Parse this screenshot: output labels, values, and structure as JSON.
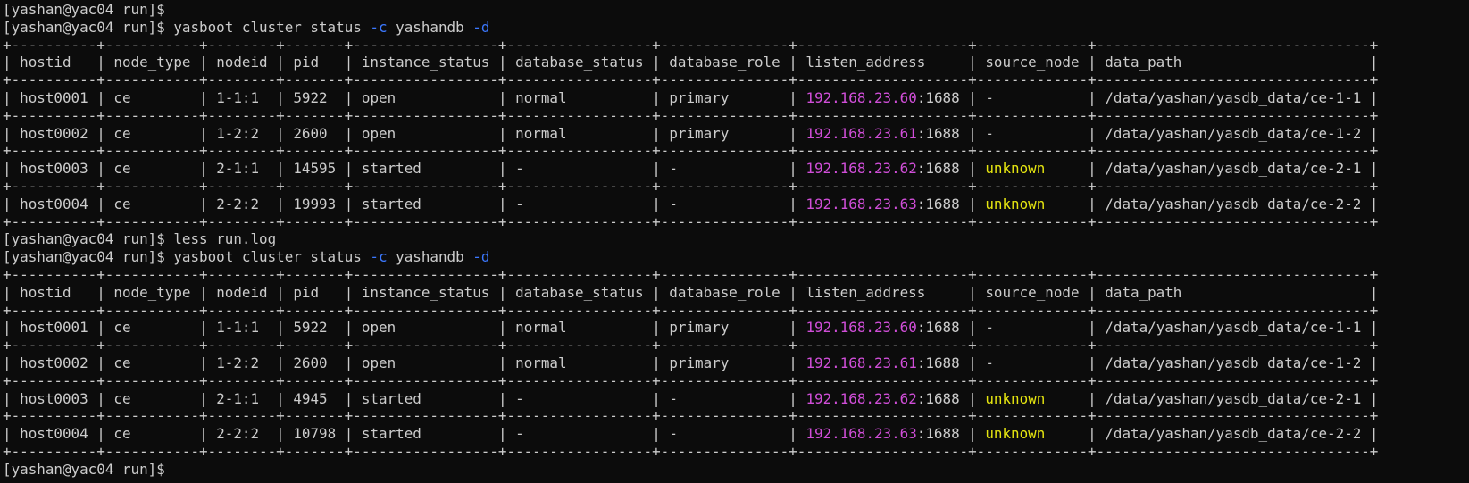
{
  "colors": {
    "background": "#0c0c0c",
    "text": "#cccccc",
    "option": "#3b78ff",
    "ip": "#d04ed8",
    "unknown": "#e5e510"
  },
  "terminal": {
    "lines": [
      {
        "kind": "prompt",
        "prompt": "[yashan@yac04 run]$",
        "cmd": ""
      },
      {
        "kind": "prompt",
        "prompt": "[yashan@yac04 run]$",
        "cmd": " yasboot cluster status",
        "opt1": "-c",
        "arg1": "yashandb",
        "opt2": "-d"
      },
      {
        "kind": "rule"
      },
      {
        "kind": "header",
        "cells": [
          "hostid",
          "node_type",
          "nodeid",
          "pid",
          "instance_status",
          "database_status",
          "database_role",
          "listen_address",
          "source_node",
          "data_path"
        ]
      },
      {
        "kind": "rule"
      },
      {
        "kind": "row",
        "hostid": "host0001",
        "node_type": "ce",
        "nodeid": "1-1:1",
        "pid": "5922",
        "instance_status": "open",
        "database_status": "normal",
        "database_role": "primary",
        "ip": "192.168.23.60",
        "port": ":1688",
        "source_node": "-",
        "source_warn": false,
        "data_path": "/data/yashan/yasdb_data/ce-1-1"
      },
      {
        "kind": "rule"
      },
      {
        "kind": "row",
        "hostid": "host0002",
        "node_type": "ce",
        "nodeid": "1-2:2",
        "pid": "2600",
        "instance_status": "open",
        "database_status": "normal",
        "database_role": "primary",
        "ip": "192.168.23.61",
        "port": ":1688",
        "source_node": "-",
        "source_warn": false,
        "data_path": "/data/yashan/yasdb_data/ce-1-2"
      },
      {
        "kind": "rule"
      },
      {
        "kind": "row",
        "hostid": "host0003",
        "node_type": "ce",
        "nodeid": "2-1:1",
        "pid": "14595",
        "instance_status": "started",
        "database_status": "-",
        "database_role": "-",
        "ip": "192.168.23.62",
        "port": ":1688",
        "source_node": "unknown",
        "source_warn": true,
        "data_path": "/data/yashan/yasdb_data/ce-2-1"
      },
      {
        "kind": "rule"
      },
      {
        "kind": "row",
        "hostid": "host0004",
        "node_type": "ce",
        "nodeid": "2-2:2",
        "pid": "19993",
        "instance_status": "started",
        "database_status": "-",
        "database_role": "-",
        "ip": "192.168.23.63",
        "port": ":1688",
        "source_node": "unknown",
        "source_warn": true,
        "data_path": "/data/yashan/yasdb_data/ce-2-2"
      },
      {
        "kind": "rule"
      },
      {
        "kind": "prompt",
        "prompt": "[yashan@yac04 run]$",
        "cmd": " less run.log"
      },
      {
        "kind": "prompt",
        "prompt": "[yashan@yac04 run]$",
        "cmd": " yasboot cluster status",
        "opt1": "-c",
        "arg1": "yashandb",
        "opt2": "-d"
      },
      {
        "kind": "rule"
      },
      {
        "kind": "header",
        "cells": [
          "hostid",
          "node_type",
          "nodeid",
          "pid",
          "instance_status",
          "database_status",
          "database_role",
          "listen_address",
          "source_node",
          "data_path"
        ]
      },
      {
        "kind": "rule"
      },
      {
        "kind": "row",
        "hostid": "host0001",
        "node_type": "ce",
        "nodeid": "1-1:1",
        "pid": "5922",
        "instance_status": "open",
        "database_status": "normal",
        "database_role": "primary",
        "ip": "192.168.23.60",
        "port": ":1688",
        "source_node": "-",
        "source_warn": false,
        "data_path": "/data/yashan/yasdb_data/ce-1-1"
      },
      {
        "kind": "rule"
      },
      {
        "kind": "row",
        "hostid": "host0002",
        "node_type": "ce",
        "nodeid": "1-2:2",
        "pid": "2600",
        "instance_status": "open",
        "database_status": "normal",
        "database_role": "primary",
        "ip": "192.168.23.61",
        "port": ":1688",
        "source_node": "-",
        "source_warn": false,
        "data_path": "/data/yashan/yasdb_data/ce-1-2"
      },
      {
        "kind": "rule"
      },
      {
        "kind": "row",
        "hostid": "host0003",
        "node_type": "ce",
        "nodeid": "2-1:1",
        "pid": "4945",
        "instance_status": "started",
        "database_status": "-",
        "database_role": "-",
        "ip": "192.168.23.62",
        "port": ":1688",
        "source_node": "unknown",
        "source_warn": true,
        "data_path": "/data/yashan/yasdb_data/ce-2-1"
      },
      {
        "kind": "rule"
      },
      {
        "kind": "row",
        "hostid": "host0004",
        "node_type": "ce",
        "nodeid": "2-2:2",
        "pid": "10798",
        "instance_status": "started",
        "database_status": "-",
        "database_role": "-",
        "ip": "192.168.23.63",
        "port": ":1688",
        "source_node": "unknown",
        "source_warn": true,
        "data_path": "/data/yashan/yasdb_data/ce-2-2"
      },
      {
        "kind": "rule"
      },
      {
        "kind": "prompt",
        "prompt": "[yashan@yac04 run]$",
        "cmd": ""
      }
    ]
  }
}
